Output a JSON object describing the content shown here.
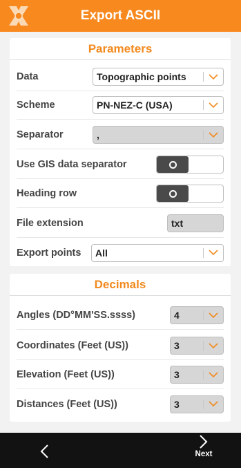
{
  "header": {
    "title": "Export ASCII"
  },
  "parameters": {
    "title": "Parameters",
    "data": {
      "label": "Data",
      "value": "Topographic points"
    },
    "scheme": {
      "label": "Scheme",
      "value": "PN-NEZ-C (USA)"
    },
    "separator": {
      "label": "Separator",
      "value": ","
    },
    "use_gis_separator": {
      "label": "Use GIS data separator",
      "state": "off"
    },
    "heading_row": {
      "label": "Heading row",
      "state": "off"
    },
    "file_extension": {
      "label": "File extension",
      "value": "txt"
    },
    "export_points": {
      "label": "Export points",
      "value": "All"
    }
  },
  "decimals": {
    "title": "Decimals",
    "angles": {
      "label": "Angles (DD°MM'SS.ssss)",
      "value": "4"
    },
    "coordinates": {
      "label": "Coordinates (Feet (US))",
      "value": "3"
    },
    "elevation": {
      "label": "Elevation (Feet (US))",
      "value": "3"
    },
    "distances": {
      "label": "Distances (Feet (US))",
      "value": "3"
    }
  },
  "bottom": {
    "next_label": "Next"
  },
  "colors": {
    "accent": "#f7891f",
    "bar": "#121212"
  }
}
